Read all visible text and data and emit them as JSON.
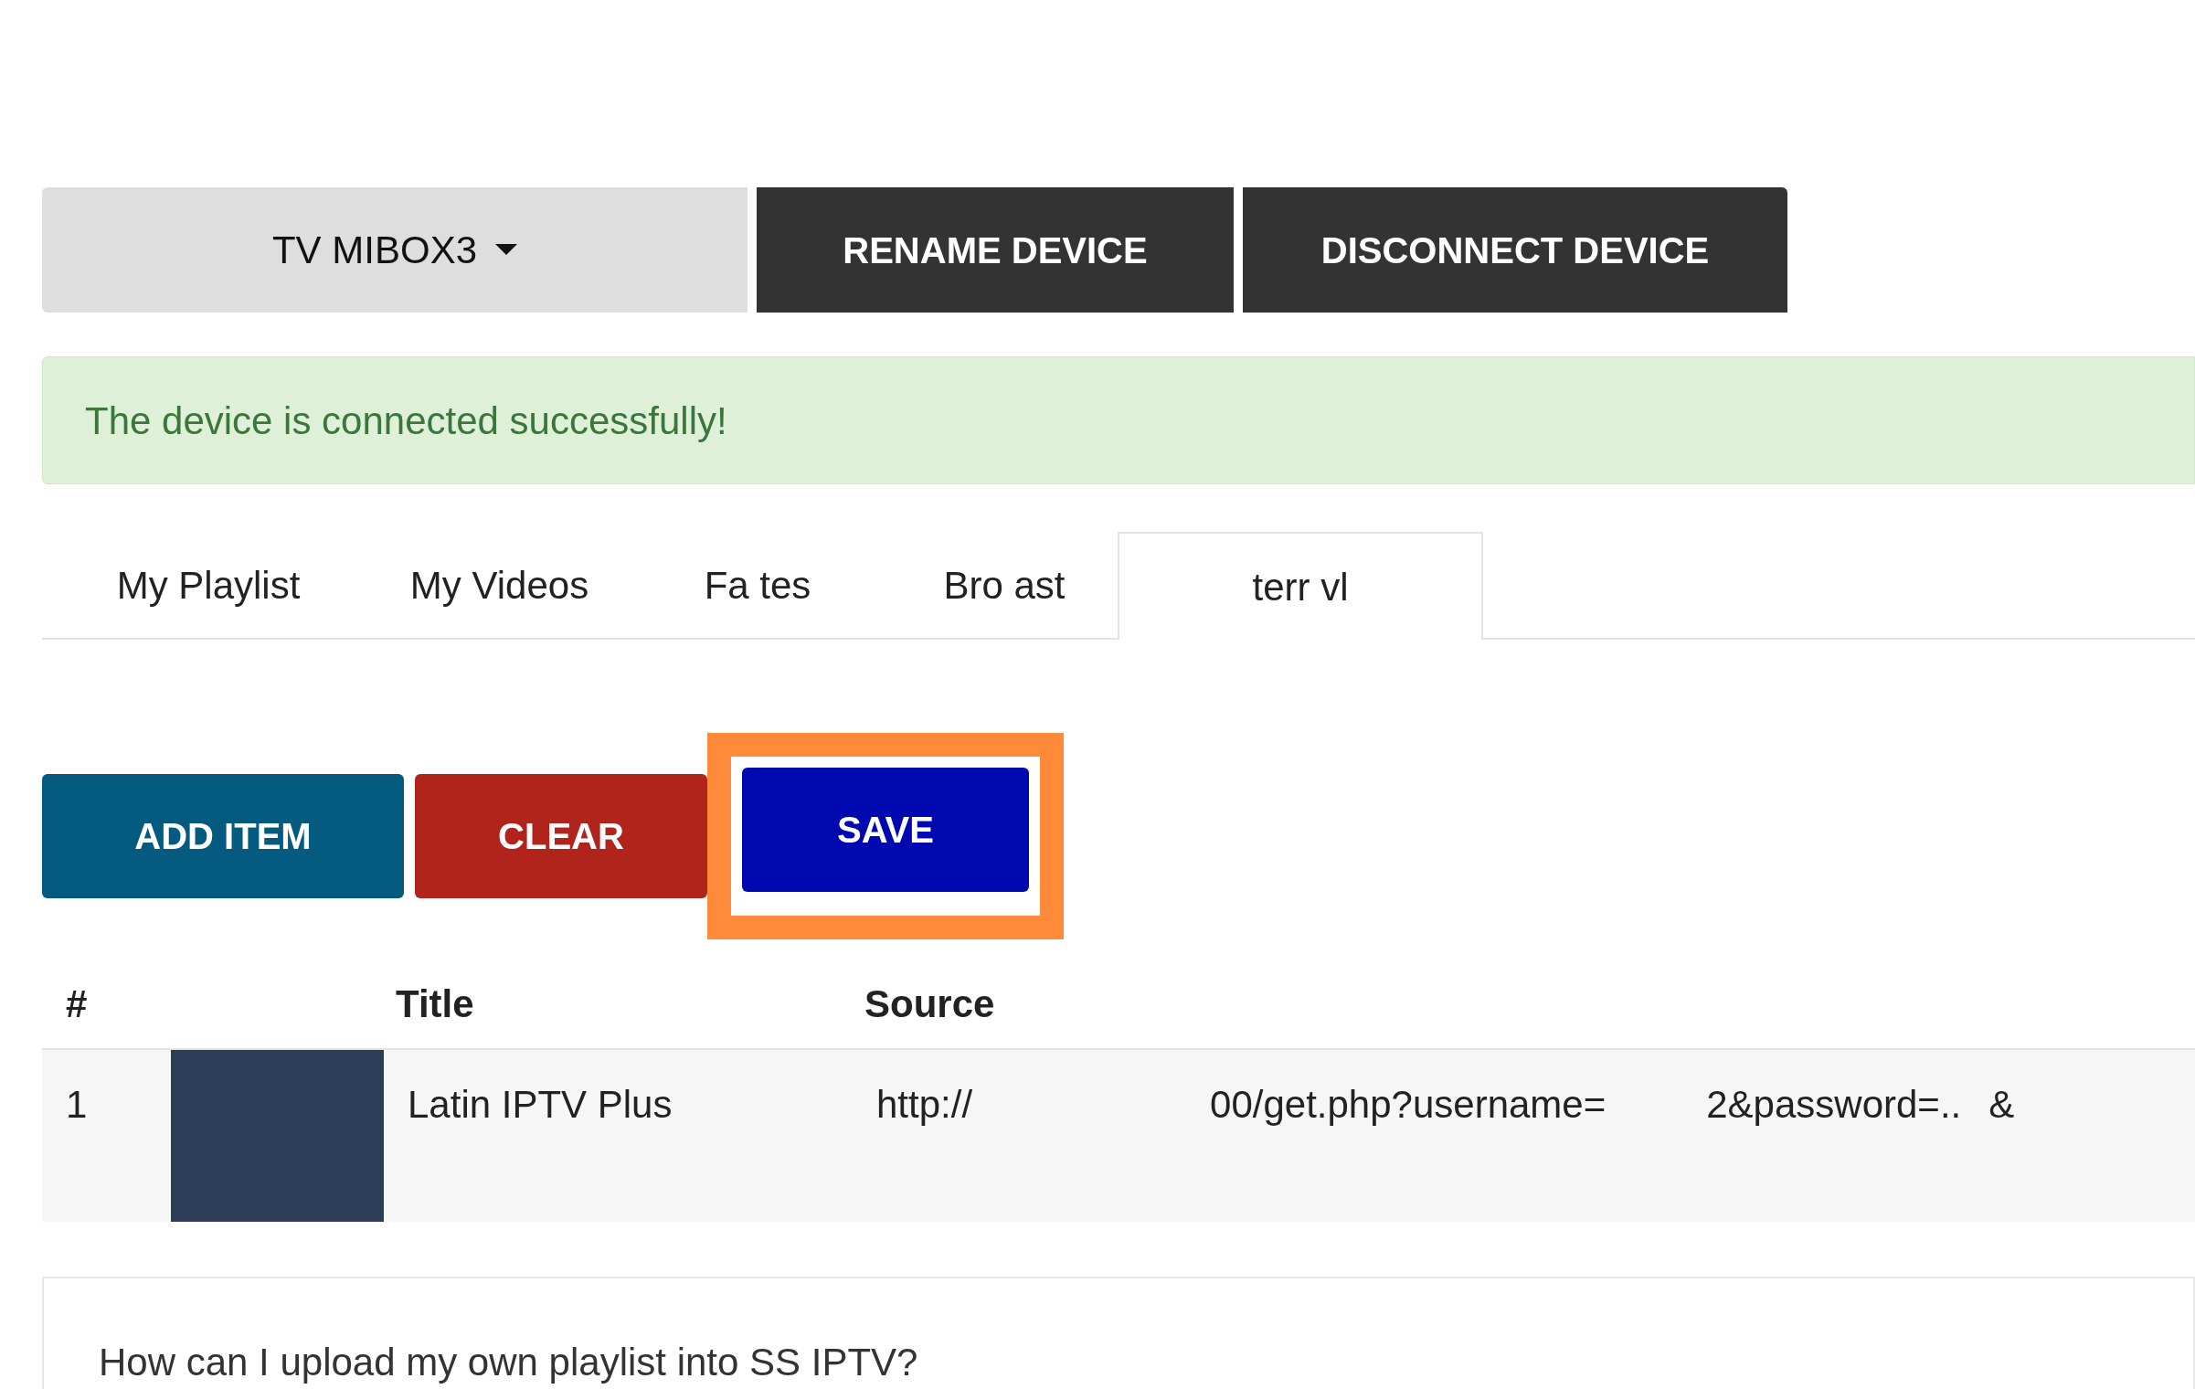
{
  "device_bar": {
    "device": "TV MIBOX3",
    "buttons": [
      "RENAME DEVICE",
      "DISCONNECT DEVICE"
    ]
  },
  "alert": {
    "text": "The device is connected successfully!"
  },
  "tabs": [
    {
      "label": "My Playlist",
      "selected": false
    },
    {
      "label": "My Videos",
      "selected": false
    },
    {
      "label": "Fa tes",
      "selected": false
    },
    {
      "label": "Bro ast",
      "selected": false
    },
    {
      "label": "terr vl",
      "selected": true
    }
  ],
  "actions": [
    {
      "label": "ADD ITEM",
      "kind": "add",
      "highlighted": false
    },
    {
      "label": "CLEAR",
      "kind": "clear",
      "highlighted": false
    },
    {
      "label": "SAVE",
      "kind": "save",
      "highlighted": true
    }
  ],
  "table": {
    "columns": [
      "#",
      "Title",
      "Source"
    ],
    "rows": [
      {
        "index": "1",
        "title": "Latin IPTV Plus",
        "source": [
          "http://",
          "00/get.php?username=",
          "2&password=..",
          "&"
        ]
      }
    ]
  },
  "faq": {
    "question": "How can I upload my own playlist into SS IPTV?"
  }
}
